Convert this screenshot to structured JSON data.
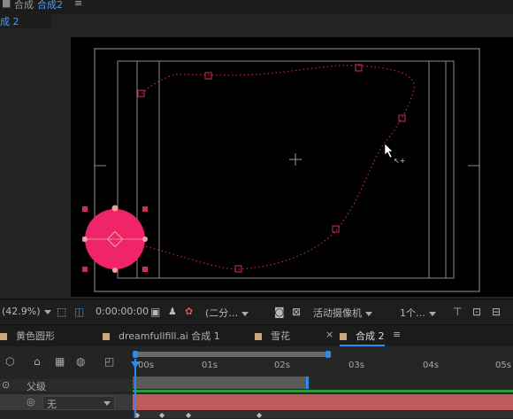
{
  "top": {
    "title_text": "合成",
    "active_comp": "合成2",
    "menu": "≡"
  },
  "subtab": {
    "label": "成 2"
  },
  "controls": {
    "zoom": "(42.9%)",
    "timecode": "0:00:00:00",
    "resolution": "(二分…",
    "camera": "活动摄像机",
    "views": "1个…"
  },
  "tabs": [
    {
      "label": "黄色圆形"
    },
    {
      "label": "dreamfullfill.ai 合成 1"
    },
    {
      "label": "雪花"
    },
    {
      "label": "合成 2"
    }
  ],
  "tabs_close": "×",
  "tabs_menu": "≡",
  "ruler": {
    "ticks": [
      "00s",
      "01s",
      "02s",
      "03s",
      "04s",
      "05s"
    ]
  },
  "layer_header": {
    "parent_label": "父级"
  },
  "layer_row": {
    "parent_value": "无"
  },
  "colors": {
    "accent": "#2d8ceb",
    "ball": "#f02468",
    "path": "#c2224a",
    "layer_bar": "#c05a5a",
    "layer_selected": "#3a3a3a"
  }
}
